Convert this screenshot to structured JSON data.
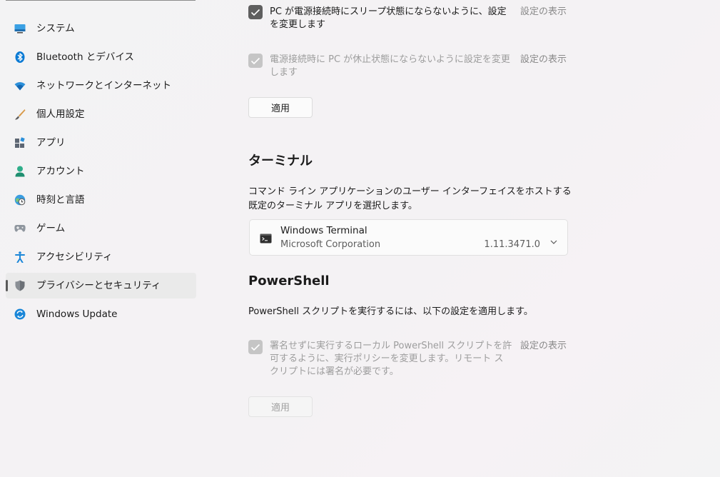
{
  "sidebar": {
    "items": [
      {
        "label": "システム",
        "icon": "monitor-icon"
      },
      {
        "label": "Bluetooth とデバイス",
        "icon": "bluetooth-icon"
      },
      {
        "label": "ネットワークとインターネット",
        "icon": "wifi-icon"
      },
      {
        "label": "個人用設定",
        "icon": "brush-icon"
      },
      {
        "label": "アプリ",
        "icon": "apps-icon"
      },
      {
        "label": "アカウント",
        "icon": "person-icon"
      },
      {
        "label": "時刻と言語",
        "icon": "globe-clock-icon"
      },
      {
        "label": "ゲーム",
        "icon": "gamepad-icon"
      },
      {
        "label": "アクセシビリティ",
        "icon": "accessibility-icon"
      },
      {
        "label": "プライバシーとセキュリティ",
        "icon": "shield-icon",
        "selected": true
      },
      {
        "label": "Windows Update",
        "icon": "sync-icon"
      }
    ]
  },
  "power": {
    "option1": {
      "text": "PC が電源接続時にスリープ状態にならないように、設定を変更します",
      "checked": true,
      "enabled": true,
      "show_settings": "設定の表示"
    },
    "option2": {
      "text": "電源接続時に PC が休止状態にならないように設定を変更します",
      "checked": true,
      "enabled": false,
      "show_settings": "設定の表示"
    },
    "apply_label": "適用"
  },
  "terminal": {
    "title": "ターミナル",
    "description": "コマンド ライン アプリケーションのユーザー インターフェイスをホストする既定のターミナル アプリを選択します。",
    "selected_app": {
      "name": "Windows Terminal",
      "publisher": "Microsoft Corporation",
      "version": "1.11.3471.0"
    }
  },
  "powershell": {
    "title": "PowerShell",
    "description": "PowerShell スクリプトを実行するには、以下の設定を適用します。",
    "option": {
      "text": "署名せずに実行するローカル PowerShell スクリプトを許可するように、実行ポリシーを変更します。リモート スクリプトには署名が必要です。",
      "checked": true,
      "enabled": false,
      "show_settings": "設定の表示"
    },
    "apply_label": "適用"
  },
  "colors": {
    "checkbox_on": "#5f5f5f",
    "checkbox_disabled": "#c5c5c5",
    "selected_indicator": "#5a5a5a",
    "bluetooth_blue": "#0a7ad4",
    "accent_blue": "#1a86d8"
  }
}
